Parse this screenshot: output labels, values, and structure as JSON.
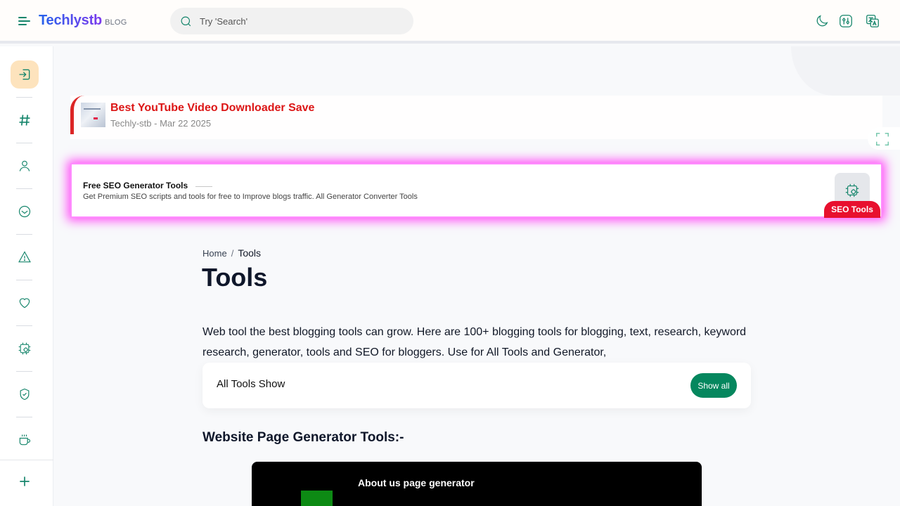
{
  "header": {
    "brand": "Techlystb",
    "brand_suffix": "BLOG",
    "search_placeholder": "Try 'Search'",
    "icons": [
      "menu-icon",
      "moon-icon",
      "settings-sliders-icon",
      "translate-icon"
    ]
  },
  "sidebar": {
    "items": [
      "login-icon",
      "hashtag-icon",
      "user-icon",
      "inbox-icon",
      "alert-icon",
      "heart-icon",
      "cpu-icon",
      "shield-icon",
      "coffee-icon",
      "plus-icon"
    ]
  },
  "featured_post": {
    "title": "Best YouTube Video Downloader Save",
    "meta": "Techly-stb - Mar 22 2025"
  },
  "seo_card": {
    "title": "Free SEO Generator Tools",
    "description": "Get Premium SEO scripts and tools for free to Improve blogs traffic. All Generator Converter Tools",
    "badge": "SEO Tools",
    "icon": "cpu-icon"
  },
  "breadcrumb": {
    "home": "Home",
    "separator": "/",
    "current": "Tools"
  },
  "page": {
    "title": "Tools",
    "intro": "Web tool the best blogging tools can grow. Here are 100+ blogging tools for blogging, text, research, keyword research, generator, tools and SEO for bloggers. Use for All Tools and Generator,"
  },
  "all_tools": {
    "label": "All Tools Show",
    "button": "Show all"
  },
  "section": {
    "heading": "Website Page Generator Tools:-"
  },
  "tool_card": {
    "title": "About us page generator"
  },
  "colors": {
    "accent": "#15856b",
    "brand_gradient_start": "#2563eb",
    "brand_gradient_end": "#7c3aed",
    "featured_title": "#dc1616",
    "badge": "#e8102e",
    "button": "#05875e",
    "glow": "#ff4cf7"
  }
}
